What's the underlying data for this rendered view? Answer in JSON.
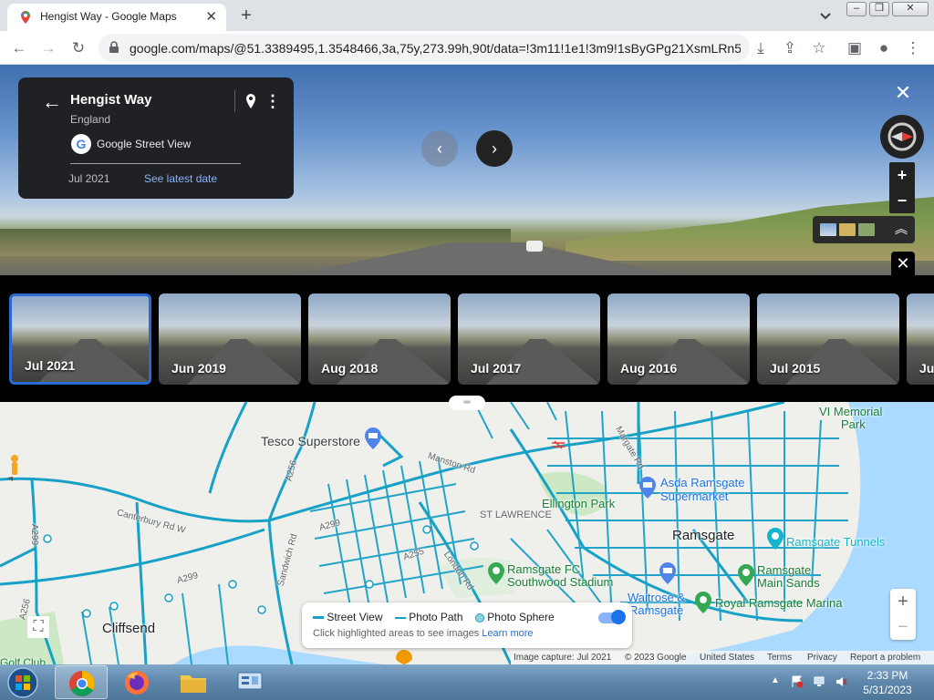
{
  "browser": {
    "tab_title": "Hengist Way - Google Maps",
    "tab_close": "✕",
    "new_tab": "+",
    "url": "google.com/maps/@51.3389495,1.3548466,3a,75y,273.99h,90t/data=!3m11!1e1!3m9!1sByGPg21XsmLRn5v...",
    "window_controls": [
      "–",
      "❐",
      "✕"
    ]
  },
  "streetview": {
    "place_name": "Hengist Way",
    "region": "England",
    "provider": "Google Street View",
    "google_letter": "G",
    "capture_date": "Jul 2021",
    "latest_link": "See latest date",
    "back_arrow": "←",
    "more_icon": "⋮",
    "prev": "‹",
    "next": "›",
    "close": "✕",
    "zoom_in": "+",
    "zoom_out": "−",
    "expand": "︽"
  },
  "timeline": {
    "close": "✕",
    "items": [
      {
        "label": "Jul 2021",
        "selected": true
      },
      {
        "label": "Jun 2019",
        "selected": false
      },
      {
        "label": "Aug 2018",
        "selected": false
      },
      {
        "label": "Jul 2017",
        "selected": false
      },
      {
        "label": "Aug 2016",
        "selected": false
      },
      {
        "label": "Jul 2015",
        "selected": false
      },
      {
        "label": "Ju",
        "selected": false
      }
    ]
  },
  "map": {
    "labels": {
      "tesco": "Tesco Superstore",
      "manston": "Manston Rd",
      "canterbury": "Canterbury Rd W",
      "a256a": "A256",
      "a256b": "A256",
      "a299a": "A299",
      "a299b": "A299",
      "a299c": "A299",
      "a255": "A255",
      "sandwich": "Sandwich Rd",
      "london": "London Rd",
      "margate": "Margate Rd",
      "st_lawrence": "ST LAWRENCE",
      "ellington": "Ellington Park",
      "asda": "Asda Ramsgate Supermarket",
      "asda_line1": "Asda Ramsgate",
      "asda_line2": "Supermarket",
      "ramsgate": "Ramsgate",
      "ramsgate_fc_1": "Ramsgate FC",
      "ramsgate_fc_2": "Southwood Stadium",
      "waitrose_1": "Waitrose &",
      "waitrose_2": "Ramsgate",
      "royal_marina": "Royal Ramsgate Marina",
      "main_sands_1": "Ramsgate",
      "main_sands_2": "Main Sands",
      "tunnels": "Ramsgate Tunnels",
      "vi_memorial_1": "VI Memorial",
      "vi_memorial_2": "Park",
      "cliffsend": "Cliffsend",
      "golf": "Golf Club"
    },
    "legend": {
      "street_view": "Street View",
      "photo_path": "Photo Path",
      "photo_sphere": "Photo Sphere",
      "hint": "Click highlighted areas to see images",
      "learn_more": "Learn more"
    },
    "zoom_in": "+",
    "zoom_out": "−",
    "drag_handle": "═",
    "expand_icon": "⛶",
    "footer": {
      "capture": "Image capture: Jul 2021",
      "copyright": "© 2023 Google",
      "country": "United States",
      "terms": "Terms",
      "privacy": "Privacy",
      "report": "Report a problem"
    },
    "colors": {
      "coverage": "#17a1c7",
      "land": "#efefeb",
      "water": "#aadaff",
      "park": "#cde8c4"
    }
  },
  "taskbar": {
    "time": "2:33 PM",
    "date": "5/31/2023"
  }
}
